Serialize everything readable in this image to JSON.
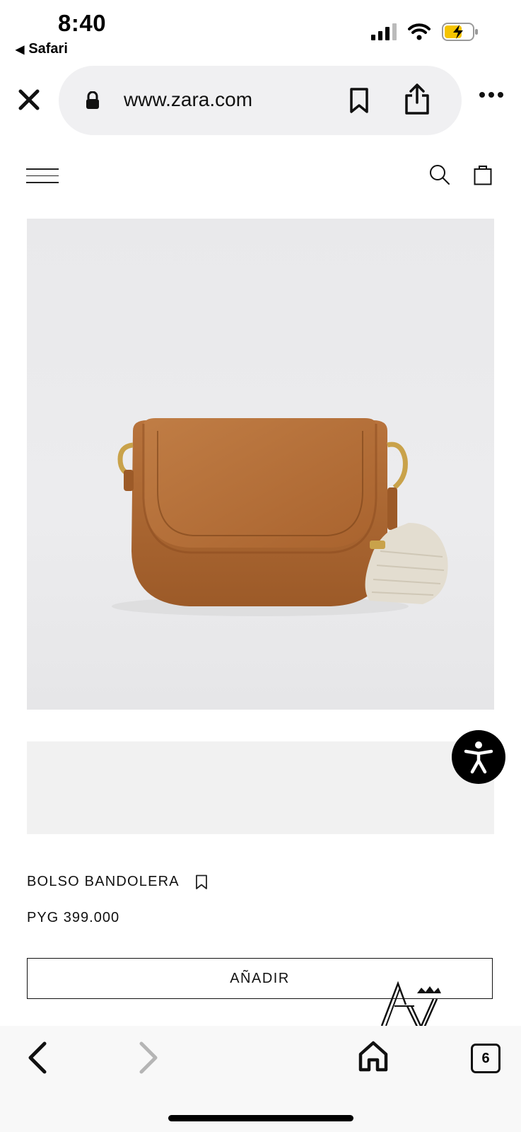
{
  "status_bar": {
    "time": "8:40",
    "back_app_label": "Safari",
    "icons": [
      "signal-icon",
      "wifi-icon",
      "battery-charging-icon"
    ]
  },
  "browser": {
    "url": "www.zara.com",
    "icons": [
      "close-icon",
      "lock-icon",
      "bookmark-icon",
      "share-icon",
      "more-icon"
    ]
  },
  "site_nav": {
    "icons": [
      "menu-icon",
      "search-icon",
      "shopping-bag-icon"
    ]
  },
  "product": {
    "name": "BOLSO BANDOLERA",
    "price": "PYG 399.000",
    "add_button_label": "AÑADIR",
    "colors": {
      "bag": "#b06a35",
      "strap": "#e3ddd0"
    }
  },
  "toolbar": {
    "tab_count": "6",
    "icons": [
      "back-icon",
      "forward-icon",
      "home-icon",
      "tabs-icon"
    ]
  }
}
